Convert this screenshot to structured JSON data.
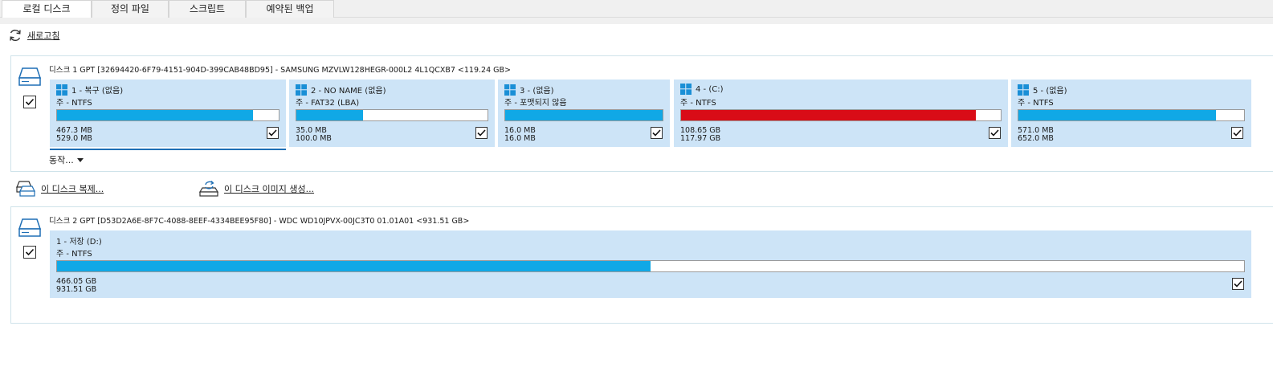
{
  "tabs": [
    {
      "label": "로컬 디스크",
      "active": true
    },
    {
      "label": "정의 파일",
      "active": false
    },
    {
      "label": "스크립트",
      "active": false
    },
    {
      "label": "예약된 백업",
      "active": false
    }
  ],
  "refresh_label": "새로고침",
  "disk1": {
    "header": "디스크 1 GPT [32694420-6F79-4151-904D-399CAB48BD95] - SAMSUNG MZVLW128HEGR-000L2 4L1QCXB7  <119.24 GB>",
    "checked": true,
    "partitions": [
      {
        "title": "1 - 복구 (없음)",
        "fs": "주 - NTFS",
        "used": "467.3 MB",
        "total": "529.0 MB",
        "fill_fraction": 0.883,
        "bar_color": "#10a8e6",
        "checked": true
      },
      {
        "title": "2 - NO NAME (없음)",
        "fs": "주 - FAT32 (LBA)",
        "used": "35.0 MB",
        "total": "100.0 MB",
        "fill_fraction": 0.35,
        "bar_color": "#10a8e6",
        "checked": true
      },
      {
        "title": "3 -  (없음)",
        "fs": "주 - 포맷되지 않음",
        "used": "16.0 MB",
        "total": "16.0 MB",
        "fill_fraction": 1.0,
        "bar_color": "#10a8e6",
        "checked": true
      },
      {
        "title": "4 -  (C:)",
        "fs": "주 - NTFS",
        "used": "108.65 GB",
        "total": "117.97 GB",
        "fill_fraction": 0.921,
        "bar_color": "#d90c17",
        "checked": true
      },
      {
        "title": "5 -  (없음)",
        "fs": "주 - NTFS",
        "used": "571.0 MB",
        "total": "652.0 MB",
        "fill_fraction": 0.876,
        "bar_color": "#10a8e6",
        "checked": true
      }
    ],
    "actions_label": "동작..."
  },
  "clone_label": "이 디스크 복제...",
  "image_label": "이 디스크 이미지 생성...",
  "disk2": {
    "header": "디스크 2 GPT [D53D2A6E-8F7C-4088-8EEF-4334BEE95F80] - WDC WD10JPVX-00JC3T0 01.01A01  <931.51 GB>",
    "checked": true,
    "partitions": [
      {
        "title": "1 - 저장 (D:)",
        "fs": "주 - NTFS",
        "used": "466.05 GB",
        "total": "931.51 GB",
        "fill_fraction": 0.5,
        "bar_color": "#10a8e6",
        "checked": true
      }
    ]
  }
}
